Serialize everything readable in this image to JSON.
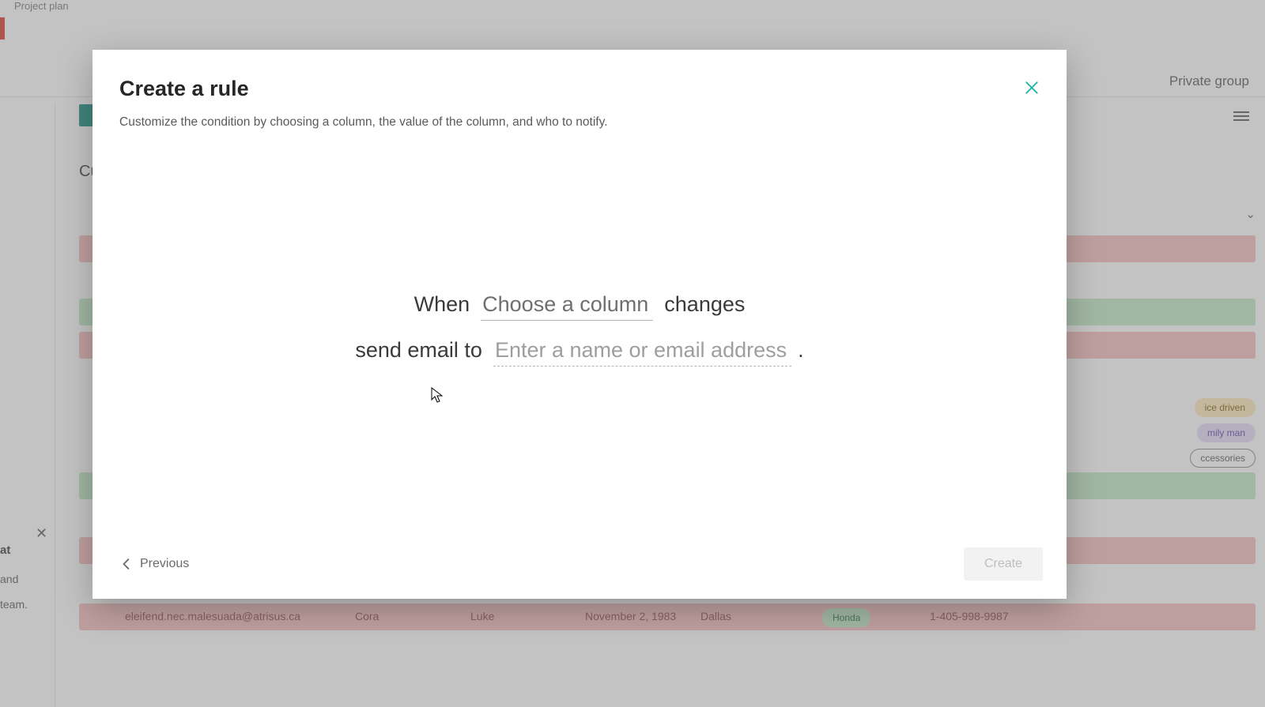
{
  "background": {
    "breadcrumb": "Project plan",
    "private_label": "Private group",
    "section_label": "Cu",
    "left_panel": {
      "title": "at",
      "line1": "and",
      "line2": "team."
    },
    "pills": {
      "p1": "ice driven",
      "p2": "mily man",
      "p3": "ccessories",
      "p4": "Honda"
    },
    "row6": {
      "email": "eleifend.nec.malesuada@atrisus.ca",
      "first": "Cora",
      "last": "Luke",
      "date": "November 2, 1983",
      "city": "Dallas",
      "phone": "1-405-998-9987"
    }
  },
  "modal": {
    "title": "Create a rule",
    "subtitle": "Customize the condition by choosing a column, the value of the column, and who to notify.",
    "line1_prefix": "When",
    "line1_slot": "Choose a column",
    "line1_suffix": "changes",
    "line2_prefix": "send email to",
    "line2_slot": "Enter a name or email address",
    "previous": "Previous",
    "create": "Create"
  }
}
